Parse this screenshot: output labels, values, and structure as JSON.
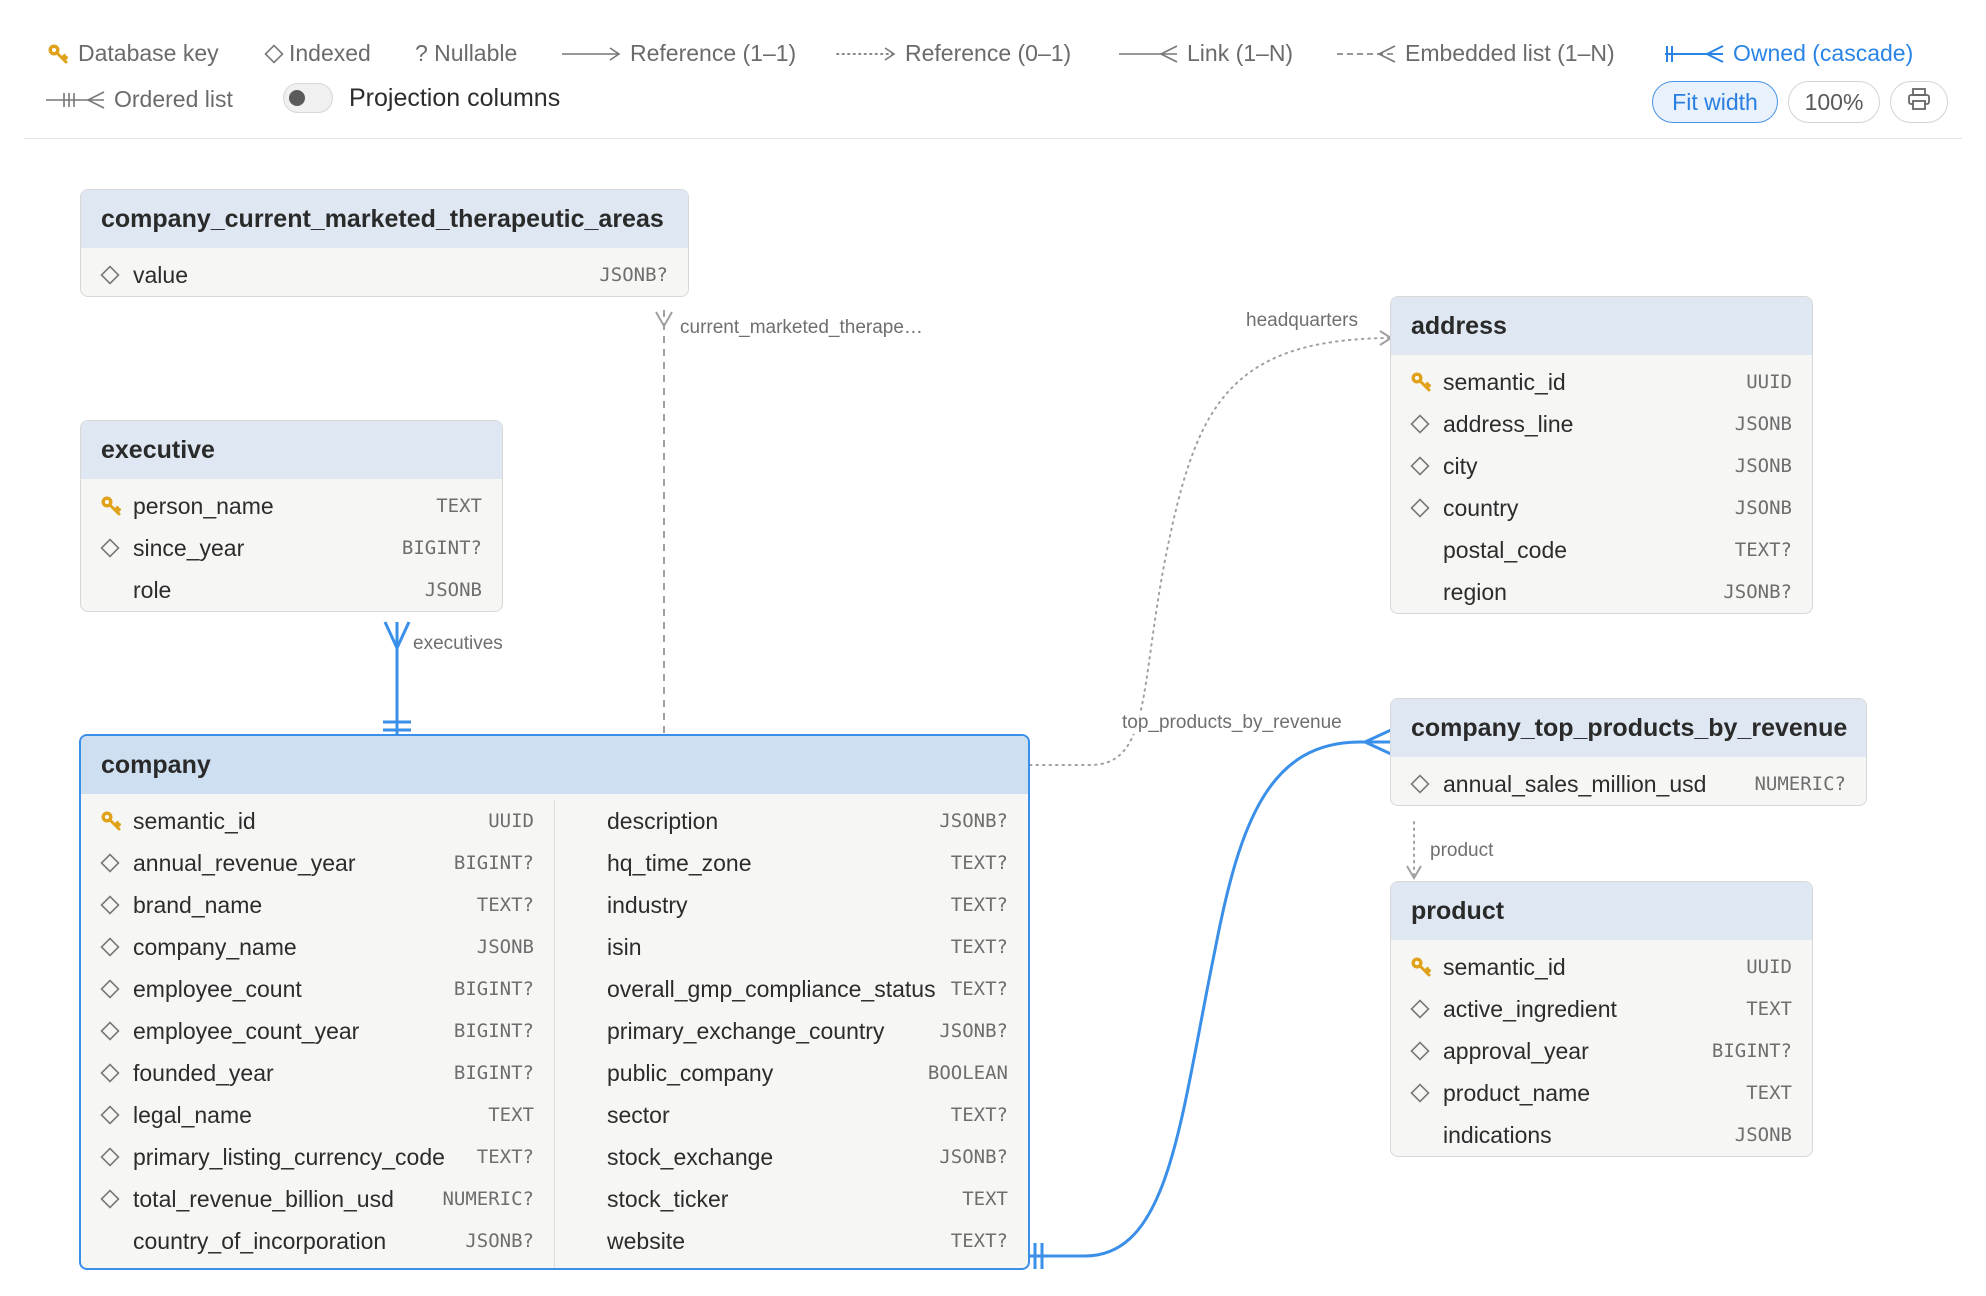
{
  "legend": [
    {
      "id": "key",
      "label": "Database key"
    },
    {
      "id": "indexed",
      "label": "Indexed"
    },
    {
      "id": "nullable",
      "label": "? Nullable"
    },
    {
      "id": "ref11",
      "label": "Reference (1–1)"
    },
    {
      "id": "ref01",
      "label": "Reference (0–1)"
    },
    {
      "id": "link1n",
      "label": "Link (1–N)"
    },
    {
      "id": "embedded",
      "label": "Embedded list (1–N)"
    },
    {
      "id": "owned",
      "label": "Owned (cascade)"
    },
    {
      "id": "ordered",
      "label": "Ordered list"
    }
  ],
  "toolbar": {
    "projection_label": "Projection columns",
    "projection_on": false,
    "fit_width_label": "Fit width",
    "zoom_label": "100%",
    "print_icon": "printer-icon"
  },
  "colors": {
    "accent": "#3a8fe8",
    "header_bg": "#dfe8f2",
    "selected_header_bg": "#cddff0",
    "key_icon": "#e0a21a",
    "edge_gray": "#a0a0a0"
  },
  "edges": [
    {
      "label": "current_marketed_therape…"
    },
    {
      "label": "headquarters"
    },
    {
      "label": "executives"
    },
    {
      "label": "top_products_by_revenue"
    },
    {
      "label": "product"
    }
  ],
  "entities": {
    "cmta": {
      "title": "company_current_marketed_therapeutic_areas",
      "columns": [
        {
          "icon": "indexed",
          "name": "value",
          "type": "JSONB?"
        }
      ]
    },
    "executive": {
      "title": "executive",
      "columns": [
        {
          "icon": "key",
          "name": "person_name",
          "type": "TEXT"
        },
        {
          "icon": "indexed",
          "name": "since_year",
          "type": "BIGINT?"
        },
        {
          "icon": "none",
          "name": "role",
          "type": "JSONB"
        }
      ]
    },
    "address": {
      "title": "address",
      "columns": [
        {
          "icon": "key",
          "name": "semantic_id",
          "type": "UUID"
        },
        {
          "icon": "indexed",
          "name": "address_line",
          "type": "JSONB"
        },
        {
          "icon": "indexed",
          "name": "city",
          "type": "JSONB"
        },
        {
          "icon": "indexed",
          "name": "country",
          "type": "JSONB"
        },
        {
          "icon": "none",
          "name": "postal_code",
          "type": "TEXT?"
        },
        {
          "icon": "none",
          "name": "region",
          "type": "JSONB?"
        }
      ]
    },
    "ctpr": {
      "title": "company_top_products_by_revenue",
      "columns": [
        {
          "icon": "indexed",
          "name": "annual_sales_million_usd",
          "type": "NUMERIC?"
        }
      ]
    },
    "product": {
      "title": "product",
      "columns": [
        {
          "icon": "key",
          "name": "semantic_id",
          "type": "UUID"
        },
        {
          "icon": "indexed",
          "name": "active_ingredient",
          "type": "TEXT"
        },
        {
          "icon": "indexed",
          "name": "approval_year",
          "type": "BIGINT?"
        },
        {
          "icon": "indexed",
          "name": "product_name",
          "type": "TEXT"
        },
        {
          "icon": "none",
          "name": "indications",
          "type": "JSONB"
        }
      ]
    },
    "company": {
      "title": "company",
      "columns_left": [
        {
          "icon": "key",
          "name": "semantic_id",
          "type": "UUID"
        },
        {
          "icon": "indexed",
          "name": "annual_revenue_year",
          "type": "BIGINT?"
        },
        {
          "icon": "indexed",
          "name": "brand_name",
          "type": "TEXT?"
        },
        {
          "icon": "indexed",
          "name": "company_name",
          "type": "JSONB"
        },
        {
          "icon": "indexed",
          "name": "employee_count",
          "type": "BIGINT?"
        },
        {
          "icon": "indexed",
          "name": "employee_count_year",
          "type": "BIGINT?"
        },
        {
          "icon": "indexed",
          "name": "founded_year",
          "type": "BIGINT?"
        },
        {
          "icon": "indexed",
          "name": "legal_name",
          "type": "TEXT"
        },
        {
          "icon": "indexed",
          "name": "primary_listing_currency_code",
          "type": "TEXT?"
        },
        {
          "icon": "indexed",
          "name": "total_revenue_billion_usd",
          "type": "NUMERIC?"
        },
        {
          "icon": "none",
          "name": "country_of_incorporation",
          "type": "JSONB?"
        }
      ],
      "columns_right": [
        {
          "icon": "none",
          "name": "description",
          "type": "JSONB?"
        },
        {
          "icon": "none",
          "name": "hq_time_zone",
          "type": "TEXT?"
        },
        {
          "icon": "none",
          "name": "industry",
          "type": "TEXT?"
        },
        {
          "icon": "none",
          "name": "isin",
          "type": "TEXT?"
        },
        {
          "icon": "none",
          "name": "overall_gmp_compliance_status",
          "type": "TEXT?"
        },
        {
          "icon": "none",
          "name": "primary_exchange_country",
          "type": "JSONB?"
        },
        {
          "icon": "none",
          "name": "public_company",
          "type": "BOOLEAN"
        },
        {
          "icon": "none",
          "name": "sector",
          "type": "TEXT?"
        },
        {
          "icon": "none",
          "name": "stock_exchange",
          "type": "JSONB?"
        },
        {
          "icon": "none",
          "name": "stock_ticker",
          "type": "TEXT"
        },
        {
          "icon": "none",
          "name": "website",
          "type": "TEXT?"
        }
      ]
    }
  }
}
